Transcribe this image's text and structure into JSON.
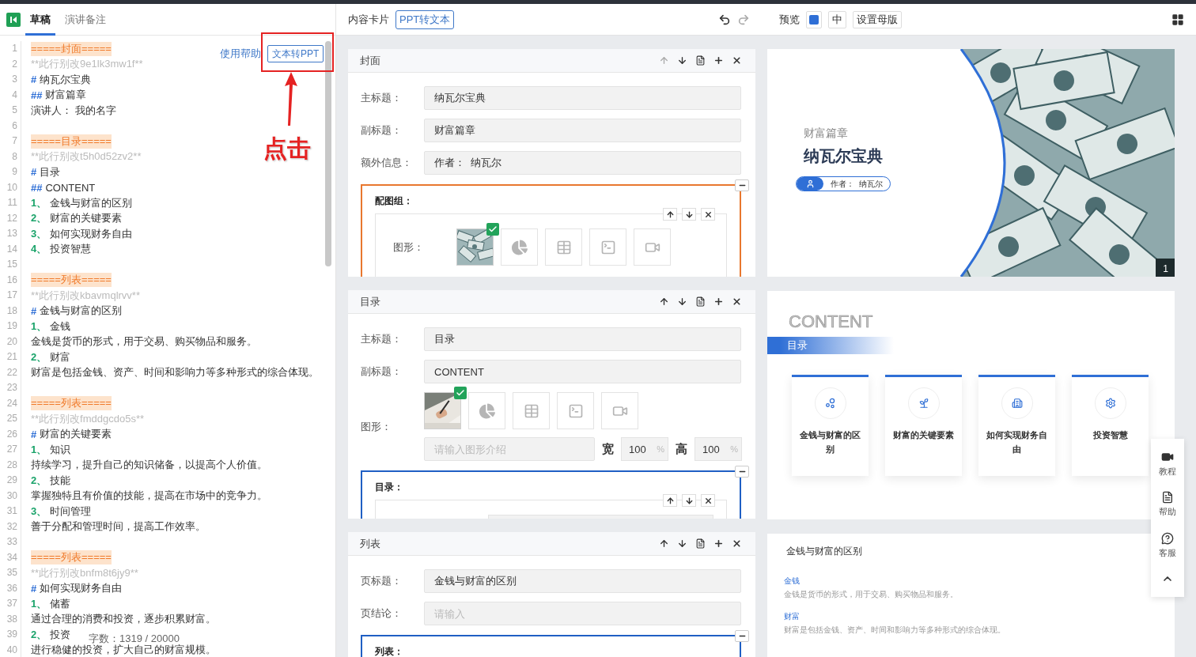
{
  "left_panel": {
    "tabs": [
      {
        "label": "草稿",
        "selected": true
      },
      {
        "label": "演讲备注",
        "selected": false
      }
    ],
    "help_link": "使用帮助",
    "convert_button": "文本转PPT",
    "lines": [
      {
        "no": "1",
        "kind": "section",
        "text": "=====封面====="
      },
      {
        "no": "2",
        "kind": "comment",
        "text": "**此行别改9e1lk3mw1f**"
      },
      {
        "no": "3",
        "kind": "heading",
        "marker": "#",
        "text": "纳瓦尔宝典"
      },
      {
        "no": "4",
        "kind": "heading",
        "marker": "##",
        "text": "财富篇章"
      },
      {
        "no": "5",
        "kind": "plain",
        "text": "演讲人：  我的名字"
      },
      {
        "no": "6",
        "kind": "blank"
      },
      {
        "no": "7",
        "kind": "section",
        "text": "=====目录====="
      },
      {
        "no": "8",
        "kind": "comment",
        "text": "**此行别改t5h0d52zv2**"
      },
      {
        "no": "9",
        "kind": "heading",
        "marker": "#",
        "text": "目录"
      },
      {
        "no": "10",
        "kind": "heading",
        "marker": "##",
        "text": "CONTENT"
      },
      {
        "no": "11",
        "kind": "item",
        "marker": "1、",
        "text": "金钱与财富的区别"
      },
      {
        "no": "12",
        "kind": "item",
        "marker": "2、",
        "text": "财富的关键要素"
      },
      {
        "no": "13",
        "kind": "item",
        "marker": "3、",
        "text": "如何实现财务自由"
      },
      {
        "no": "14",
        "kind": "item",
        "marker": "4、",
        "text": "投资智慧"
      },
      {
        "no": "15",
        "kind": "blank"
      },
      {
        "no": "16",
        "kind": "section",
        "text": "=====列表====="
      },
      {
        "no": "17",
        "kind": "comment",
        "text": "**此行别改kbavmqlrvv**"
      },
      {
        "no": "18",
        "kind": "heading",
        "marker": "#",
        "text": "金钱与财富的区别"
      },
      {
        "no": "19",
        "kind": "item",
        "marker": "1、",
        "text": "金钱"
      },
      {
        "no": "20",
        "kind": "plain",
        "text": "金钱是货币的形式，用于交易、购买物品和服务。"
      },
      {
        "no": "21",
        "kind": "item",
        "marker": "2、",
        "text": "财富"
      },
      {
        "no": "22",
        "kind": "plain",
        "text": "财富是包括金钱、资产、时间和影响力等多种形式的综合体现。"
      },
      {
        "no": "23",
        "kind": "blank"
      },
      {
        "no": "24",
        "kind": "section",
        "text": "=====列表====="
      },
      {
        "no": "25",
        "kind": "comment",
        "text": "**此行别改fmddgcdo5s**"
      },
      {
        "no": "26",
        "kind": "heading",
        "marker": "#",
        "text": "财富的关键要素"
      },
      {
        "no": "27",
        "kind": "item",
        "marker": "1、",
        "text": "知识"
      },
      {
        "no": "28",
        "kind": "plain",
        "text": "持续学习，提升自己的知识储备，以提高个人价值。"
      },
      {
        "no": "29",
        "kind": "item",
        "marker": "2、",
        "text": "技能"
      },
      {
        "no": "30",
        "kind": "plain",
        "text": "掌握独特且有价值的技能，提高在市场中的竞争力。"
      },
      {
        "no": "31",
        "kind": "item",
        "marker": "3、",
        "text": "时间管理"
      },
      {
        "no": "32",
        "kind": "plain",
        "text": "善于分配和管理时间，提高工作效率。"
      },
      {
        "no": "33",
        "kind": "blank"
      },
      {
        "no": "34",
        "kind": "section",
        "text": "=====列表====="
      },
      {
        "no": "35",
        "kind": "comment",
        "text": "**此行别改bnfm8t6jy9**"
      },
      {
        "no": "36",
        "kind": "heading",
        "marker": "#",
        "text": "如何实现财务自由"
      },
      {
        "no": "37",
        "kind": "item",
        "marker": "1、",
        "text": "储蓄"
      },
      {
        "no": "38",
        "kind": "plain",
        "text": "通过合理的消费和投资，逐步积累财富。"
      },
      {
        "no": "39",
        "kind": "item",
        "marker": "2、",
        "text": "投资"
      },
      {
        "no": "40",
        "kind": "plain",
        "text": "进行稳健的投资，扩大自己的财富规模。"
      }
    ],
    "word_count": "字数：1319 / 20000",
    "annotation": {
      "text": "点击"
    }
  },
  "middle_panel": {
    "title": "内容卡片",
    "convert_button": "PPT转文本",
    "redo_disabled": true,
    "cards": [
      {
        "title": "封面",
        "move_up_disabled": true,
        "rows": [
          {
            "kind": "field",
            "label": "主标题：",
            "value": "纳瓦尔宝典"
          },
          {
            "kind": "field",
            "label": "副标题：",
            "value": "财富篇章"
          },
          {
            "kind": "field",
            "label": "额外信息：",
            "value": "作者：  纳瓦尔"
          },
          {
            "kind": "group",
            "title": "配图组：",
            "color": "#e8772e",
            "figure": {
              "label": "图形：",
              "thumbs": [
                {
                  "kind": "picture",
                  "selected": true
                },
                {
                  "kind": "chart",
                  "selected": false
                },
                {
                  "kind": "table",
                  "selected": false
                },
                {
                  "kind": "terminal",
                  "selected": false
                },
                {
                  "kind": "video",
                  "selected": false
                }
              ]
            }
          }
        ]
      },
      {
        "title": "目录",
        "move_up_disabled": false,
        "rows": [
          {
            "kind": "field",
            "label": "主标题：",
            "value": "目录"
          },
          {
            "kind": "field",
            "label": "副标题：",
            "value": "CONTENT"
          },
          {
            "kind": "figure",
            "label": "图形：",
            "thumbs": [
              {
                "kind": "picture",
                "selected": true
              },
              {
                "kind": "chart",
                "selected": false
              },
              {
                "kind": "table",
                "selected": false
              },
              {
                "kind": "terminal",
                "selected": false
              },
              {
                "kind": "video",
                "selected": false
              }
            ],
            "caption_placeholder": "请输入图形介绍",
            "width_label": "宽",
            "width_value": "100",
            "width_unit": "%",
            "height_label": "高",
            "height_value": "100",
            "height_unit": "%"
          },
          {
            "kind": "group",
            "title": "目录：",
            "color": "#1f5fc4"
          }
        ]
      },
      {
        "title": "列表",
        "move_up_disabled": false,
        "rows": [
          {
            "kind": "field",
            "label": "页标题：",
            "value": "金钱与财富的区别"
          },
          {
            "kind": "field",
            "label": "页结论：",
            "placeholder": "请输入"
          },
          {
            "kind": "group",
            "title": "列表：",
            "color": "#1f5fc4"
          }
        ]
      }
    ]
  },
  "preview_panel": {
    "title": "预览",
    "controls": [
      {
        "kind": "swatch"
      },
      {
        "kind": "text",
        "label": "中"
      },
      {
        "kind": "text",
        "label": "设置母版"
      }
    ],
    "slides": [
      {
        "kind": "cover",
        "subtitle": "财富篇章",
        "title": "纳瓦尔宝典",
        "author": "作者：  纳瓦尔",
        "page": "1"
      },
      {
        "kind": "toc",
        "ghost": "CONTENT",
        "band": "目录",
        "items": [
          {
            "label": "金钱与财富的区别"
          },
          {
            "label": "财富的关键要素"
          },
          {
            "label": "如何实现财务自由"
          },
          {
            "label": "投资智慧"
          }
        ]
      },
      {
        "kind": "list",
        "title": "金钱与财富的区别",
        "entries": [
          {
            "heading": "金钱",
            "body": "金钱是货币的形式，用于交易、购买物品和服务。"
          },
          {
            "heading": "财富",
            "body": "财富是包括金钱、资产、时间和影响力等多种形式的综合体现。"
          }
        ]
      }
    ],
    "float_bar": [
      {
        "kind": "video",
        "label": "教程"
      },
      {
        "kind": "doc",
        "label": "帮助"
      },
      {
        "kind": "chat",
        "label": "客服"
      },
      {
        "kind": "top"
      }
    ]
  }
}
